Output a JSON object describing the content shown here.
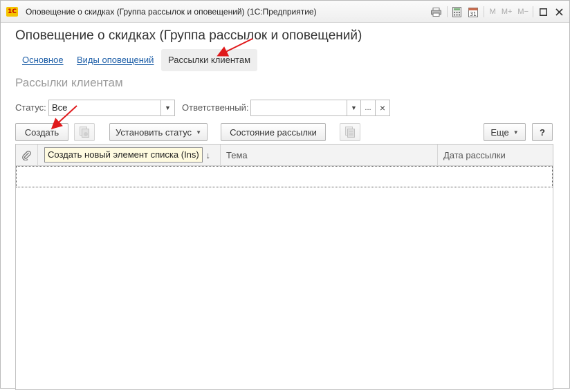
{
  "window": {
    "logo_text": "1С",
    "title": "Оповещение о скидках (Группа рассылок и оповещений)  (1С:Предприятие)",
    "m_label": "M",
    "mplus_label": "M+",
    "mminus_label": "M−",
    "calendar_day": "31"
  },
  "form": {
    "title": "Оповещение о скидках (Группа рассылок и оповещений)"
  },
  "tabs": [
    {
      "label": "Основное"
    },
    {
      "label": "Виды оповещений"
    },
    {
      "label": "Рассылки клиентам"
    }
  ],
  "section": {
    "title": "Рассылки клиентам"
  },
  "filters": {
    "status_label": "Статус:",
    "status_value": "Все",
    "responsible_label": "Ответственный:",
    "responsible_value": "",
    "more_button": "...",
    "clear_button": "×"
  },
  "toolbar": {
    "create_label": "Создать",
    "set_status_label": "Установить статус",
    "mailing_state_label": "Состояние рассылки",
    "more_label": "Еще",
    "help_label": "?"
  },
  "table": {
    "sort_indicator": "↓",
    "columns": [
      "Тема",
      "Дата рассылки"
    ]
  },
  "tooltip": {
    "text": "Создать новый элемент списка (Ins)"
  },
  "colors": {
    "link": "#1e5fa8",
    "annotation_arrow": "#e0191b"
  }
}
